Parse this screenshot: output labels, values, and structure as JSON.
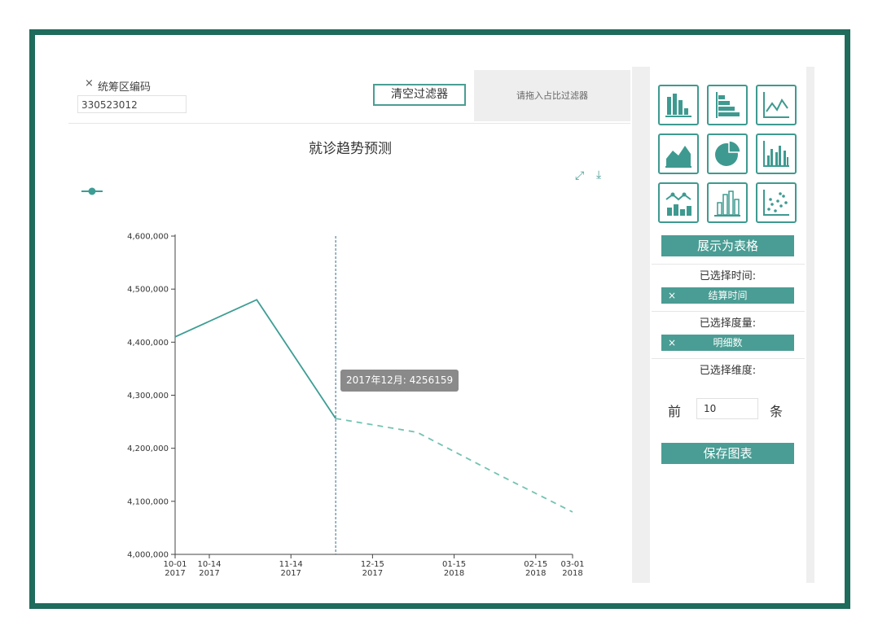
{
  "filter": {
    "close_icon": "×",
    "label": "统筹区编码",
    "value": "330523012"
  },
  "toolbar": {
    "clear_label": "清空过滤器",
    "drop_hint": "请拖入占比过滤器"
  },
  "chart_data": {
    "type": "line",
    "title": "就诊趋势预测",
    "xlabel": "",
    "ylabel": "",
    "ylim": [
      4000000,
      4600000
    ],
    "y_ticks": [
      "4,600,000",
      "4,500,000",
      "4,400,000",
      "4,300,000",
      "4,200,000",
      "4,100,000",
      "4,000,000"
    ],
    "x_ticks": [
      {
        "date": "2017-10-01",
        "line1": "10-01",
        "line2": "2017"
      },
      {
        "date": "2017-10-14",
        "line1": "10-14",
        "line2": "2017"
      },
      {
        "date": "2017-11-14",
        "line1": "11-14",
        "line2": "2017"
      },
      {
        "date": "2017-12-15",
        "line1": "12-15",
        "line2": "2017"
      },
      {
        "date": "2018-01-15",
        "line1": "01-15",
        "line2": "2018"
      },
      {
        "date": "2018-02-15",
        "line1": "02-15",
        "line2": "2018"
      },
      {
        "date": "2018-03-01",
        "line1": "03-01",
        "line2": "2018"
      }
    ],
    "series": [
      {
        "style": "solid",
        "color": "#3d9d94",
        "points": [
          {
            "x": "2017-10-01",
            "y": 4410000
          },
          {
            "x": "2017-11-01",
            "y": 4480000
          },
          {
            "x": "2017-12-01",
            "y": 4256159
          }
        ]
      },
      {
        "style": "dashed",
        "color": "#73c3b2",
        "points": [
          {
            "x": "2017-12-01",
            "y": 4256159
          },
          {
            "x": "2018-01-01",
            "y": 4230000
          },
          {
            "x": "2018-02-01",
            "y": 4150000
          },
          {
            "x": "2018-03-01",
            "y": 4080000
          }
        ]
      }
    ],
    "crosshair": {
      "x": "2017-12-01"
    },
    "tooltip": "2017年12月: 4256159",
    "grid": false,
    "legend": "top-left"
  },
  "chart_types": [
    "bar",
    "horizontal-bar",
    "line",
    "area",
    "pie",
    "grouped-bar",
    "line-bar",
    "histogram",
    "scatter"
  ],
  "panel": {
    "table_label": "展示为表格",
    "time_label": "已选择时间:",
    "time_chip": "结算时间",
    "measure_label": "已选择度量:",
    "measure_chip": "明细数",
    "dimension_label": "已选择维度:",
    "topn_prefix": "前",
    "topn_value": "10",
    "topn_suffix": "条",
    "save_label": "保存图表",
    "chip_close": "×"
  },
  "colors": {
    "frame": "#1f6b5c",
    "accent": "#4a9d94",
    "line": "#3d9d94",
    "forecast": "#73c3b2"
  }
}
